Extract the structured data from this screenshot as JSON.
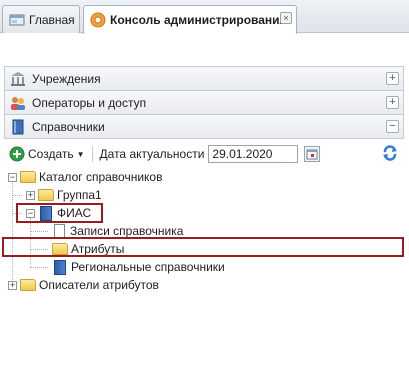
{
  "tabs": [
    {
      "label": "Главная",
      "icon": "home-icon",
      "active": false
    },
    {
      "label": "Консоль администрирования",
      "icon": "settings-gear-icon",
      "active": true,
      "close": "×"
    }
  ],
  "accordion": [
    {
      "label": "Учреждения",
      "icon": "institution-icon",
      "toggle": "+"
    },
    {
      "label": "Операторы и доступ",
      "icon": "users-icon",
      "toggle": "+"
    },
    {
      "label": "Справочники",
      "icon": "book-icon",
      "toggle": "−"
    }
  ],
  "toolbar": {
    "create_label": "Создать",
    "date_label": "Дата актуальности",
    "date_value": "29.01.2020"
  },
  "tree": {
    "catalog": "Каталог справочников",
    "group1": "Группа1",
    "fias": "ФИАС",
    "records": "Записи справочника",
    "attributes": "Атрибуты",
    "regional": "Региональные справочники",
    "descriptors": "Описатели атрибутов"
  },
  "colors": {
    "highlight": "#9a1b22",
    "accent_blue": "#2d5fa8",
    "folder": "#f2c94c",
    "add_green": "#2ea043"
  }
}
